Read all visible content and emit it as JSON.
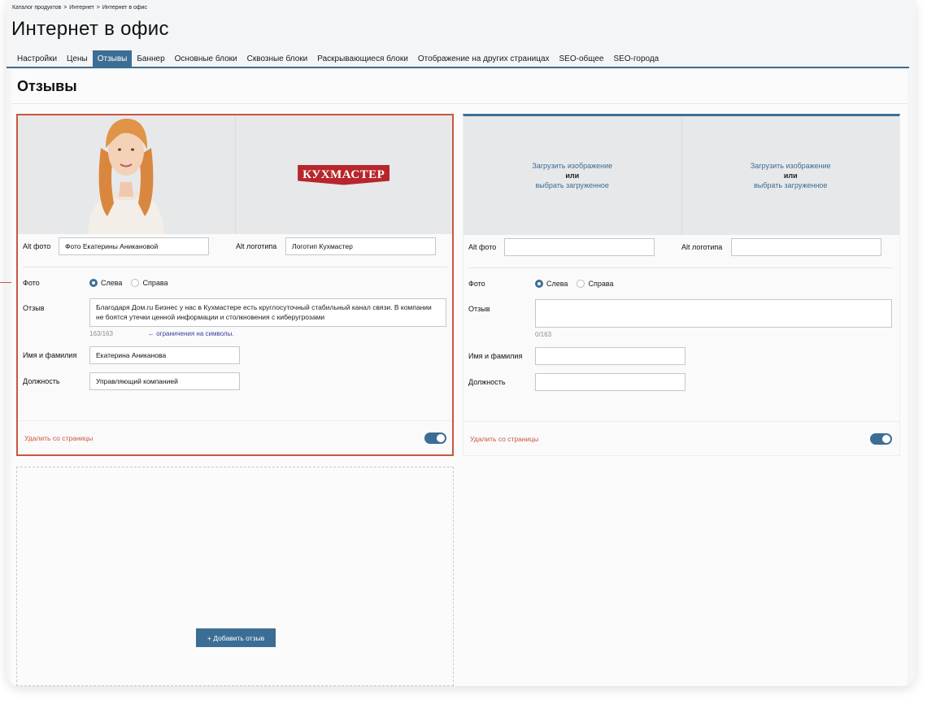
{
  "breadcrumb": {
    "items": [
      "Каталог продуктов",
      ">",
      "Интернет",
      ">",
      "Интернет в офис"
    ]
  },
  "page_title": "Интернет в офис",
  "tabs": [
    {
      "label": "Настройки",
      "active": false
    },
    {
      "label": "Цены",
      "active": false
    },
    {
      "label": "Отзывы",
      "active": true
    },
    {
      "label": "Баннер",
      "active": false
    },
    {
      "label": "Основные блоки",
      "active": false
    },
    {
      "label": "Сквозные блоки",
      "active": false
    },
    {
      "label": "Раскрывающиеся блоки",
      "active": false
    },
    {
      "label": "Отображение на других страницах",
      "active": false
    },
    {
      "label": "SEO-общее",
      "active": false
    },
    {
      "label": "SEO-города",
      "active": false
    }
  ],
  "section_title": "Отзывы",
  "review1": {
    "logo_text": "КУХМАСТЕР",
    "alt_photo_label": "Alt фото",
    "alt_photo_value": "Фото Екатерины Аникановой",
    "alt_logo_label": "Alt логотипа",
    "alt_logo_value": "Логотип Кухмастер",
    "photo_label": "Фото",
    "radio_left": "Слева",
    "radio_right": "Справа",
    "review_label": "Отзыв",
    "review_text": "Благодаря Дом.ru Бизнес у нас в Кухмастере есть круглосуточный стабильный канал связи. В компании не боятся утечки ценной информации и столкновения с киберугрозами",
    "counter": "163/163",
    "hint": "← ограничения на символы.",
    "name_label": "Имя и фамилия",
    "name_value": "Екатерина Аниканова",
    "position_label": "Должность",
    "position_value": "Управляющий компанией",
    "delete_label": "Удалить со страницы"
  },
  "review2": {
    "upload_line1": "Загрузить изображение",
    "upload_or": "или",
    "upload_line2": "выбрать загруженное",
    "alt_photo_label": "Alt фото",
    "alt_logo_label": "Alt логотипа",
    "photo_label": "Фото",
    "radio_left": "Слева",
    "radio_right": "Справа",
    "review_label": "Отзыв",
    "counter": "0/163",
    "name_label": "Имя и фамилия",
    "position_label": "Должность",
    "delete_label": "Удалить со страницы"
  },
  "add_button": "+ Добавить отзыв",
  "colors": {
    "accent": "#3c6e95",
    "danger": "#c9573f",
    "logo_red": "#b7262b"
  }
}
